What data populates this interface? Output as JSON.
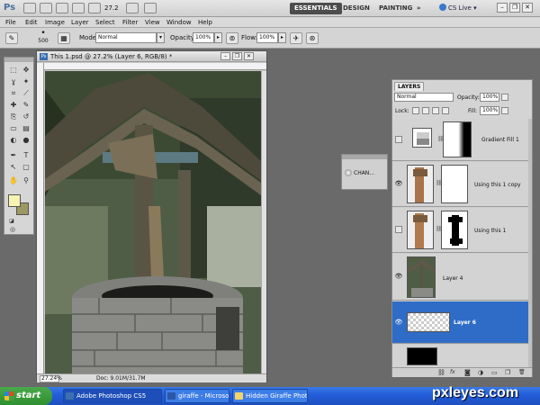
{
  "app": {
    "logo": "Ps",
    "zoom_value": "27.2",
    "workspaces": [
      "ESSENTIALS",
      "DESIGN",
      "PAINTING"
    ],
    "more": "»",
    "cslive": "CS Live",
    "cslive_arrow": "▾"
  },
  "menu": [
    "File",
    "Edit",
    "Image",
    "Layer",
    "Select",
    "Filter",
    "View",
    "Window",
    "Help"
  ],
  "options": {
    "brush_size": "500",
    "mode_label": "Mode:",
    "mode_value": "Normal",
    "opacity_label": "Opacity:",
    "opacity_value": "100%",
    "flow_label": "Flow:",
    "flow_value": "100%"
  },
  "toolbox": {
    "icons": [
      "marquee-icon",
      "move-icon",
      "lasso-icon",
      "magic-wand-icon",
      "crop-icon",
      "eyedropper-icon",
      "healing-icon",
      "brush-icon",
      "clone-stamp-icon",
      "history-brush-icon",
      "eraser-icon",
      "gradient-icon",
      "blur-icon",
      "dodge-icon",
      "pen-icon",
      "type-icon",
      "path-select-icon",
      "shape-icon",
      "hand-icon",
      "zoom-icon"
    ],
    "glyphs": [
      "⬚",
      "✥",
      "ɣ",
      "✦",
      "⌗",
      "⟋",
      "✚",
      "✎",
      "⎘",
      "↺",
      "▭",
      "▤",
      "◐",
      "●",
      "✒",
      "T",
      "↖",
      "▢",
      "✋",
      "⚲"
    ],
    "foreground_color": "#f7f3b2",
    "background_color": "#9b9862"
  },
  "document": {
    "title": "This 1.psd @ 27.2% (Layer 6, RGB/8) *",
    "zoom": "27.24%",
    "doc_info": "Doc: 9.01M/31.7M"
  },
  "channels_panel": {
    "label": "CHAN..."
  },
  "layers": {
    "tab": "LAYERS",
    "blend_mode": "Normal",
    "opacity_label": "Opacity:",
    "opacity_value": "100%",
    "lock_label": "Lock:",
    "fill_label": "Fill:",
    "fill_value": "100%",
    "items": [
      {
        "name": "Gradient Fill 1",
        "visible": false,
        "selected": false
      },
      {
        "name": "Using this 1 copy",
        "visible": true,
        "selected": false
      },
      {
        "name": "Using this 1",
        "visible": false,
        "selected": false
      },
      {
        "name": "Layer 4",
        "visible": true,
        "selected": false
      },
      {
        "name": "Layer 6",
        "visible": true,
        "selected": true
      },
      {
        "name": "",
        "visible": false,
        "selected": false
      }
    ],
    "footer_icons": [
      "link-icon",
      "fx-icon",
      "mask-icon",
      "adjustment-icon",
      "folder-icon",
      "new-layer-icon",
      "trash-icon"
    ],
    "footer_glyphs": [
      "⛓",
      "fx",
      "◙",
      "◑",
      "▭",
      "❐",
      "🗑"
    ]
  },
  "taskbar": {
    "start": "start",
    "tasks": [
      "Adobe Photoshop CS5",
      "giraffe - Microsoft Word",
      "Hidden Giraffe Photos..."
    ]
  },
  "watermark": "pxleyes.com"
}
